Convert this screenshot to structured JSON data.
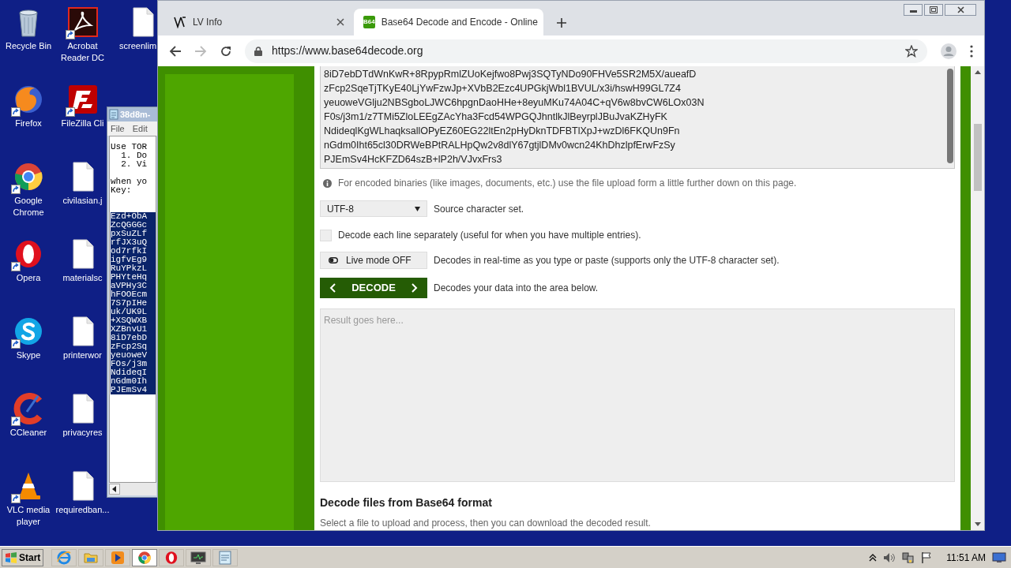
{
  "desktop": {
    "columns": [
      [
        {
          "label": "Recycle Bin",
          "kind": "recycle"
        },
        {
          "label": "Firefox",
          "kind": "firefox"
        },
        {
          "label": "Google Chrome",
          "kind": "chrome"
        },
        {
          "label": "Opera",
          "kind": "opera"
        },
        {
          "label": "Skype",
          "kind": "skype"
        },
        {
          "label": "CCleaner",
          "kind": "ccleaner"
        },
        {
          "label": "VLC media player",
          "kind": "vlc"
        }
      ],
      [
        {
          "label": "Acrobat Reader DC",
          "kind": "acrobat"
        },
        {
          "label": "FileZilla Cli",
          "kind": "filezilla"
        },
        {
          "label": "civilasian.j",
          "kind": "file"
        },
        {
          "label": "materialsc",
          "kind": "file"
        },
        {
          "label": "printerwor",
          "kind": "file"
        },
        {
          "label": "privacyres",
          "kind": "file"
        },
        {
          "label": "requiredban...",
          "kind": "file"
        }
      ],
      [
        {
          "label": "screenlim",
          "kind": "file"
        }
      ]
    ]
  },
  "notepad": {
    "title": "38d8m-",
    "menu": [
      "File",
      "Edit"
    ],
    "paragraphs": [
      [
        "Use TOR",
        "  1. Do",
        "  2. Vi"
      ],
      [
        "when yo",
        "Key:"
      ]
    ],
    "selected_lines": [
      "Ezd+ObA",
      "ZcQGGGc",
      "pxSuZLf",
      "rfJX3uQ",
      "od7rfkI",
      "igfvEg9",
      "RuYPkzL",
      "PHYteHq",
      "aVPHy3C",
      "hFOOEcm",
      "7S7pIHe",
      "uk/UK9L",
      "+XSQWXB",
      "XZBnvU1",
      "8iD7ebD",
      "zFcp2Sq",
      "yeuoweV",
      "FOs/j3m",
      "NdideqI",
      "nGdm0Ih",
      "PJEmSv4"
    ]
  },
  "browser": {
    "tabs": [
      {
        "title": "LV Info",
        "kind": "lv",
        "selected": false
      },
      {
        "title": "Base64 Decode and Encode - Online",
        "kind": "b64",
        "favicon_text": "B64",
        "selected": true
      }
    ],
    "url": "https://www.base64decode.org",
    "page": {
      "input_lines": [
        "8iD7ebDTdWnKwR+8RpypRmlZUoKejfwo8Pwj3SQTyNDo90FHVe5SR2M5X/aueafD",
        "zFcp2SqeTjTKyE40LjYwFzwJp+XVbB2Ezc4UPGkjWbl1BVUL/x3i/hswH99GL7Z4",
        "yeuoweVGlju2NBSgboLJWC6hpgnDaoHHe+8eyuMKu74A04C+qV6w8bvCW6LOx03N",
        "F0s/j3m1/z7TMi5ZloLEEgZAcYha3Fcd54WPGQJhntlkJlBeyrplJBuJvaKZHyFK",
        "NdideqlKgWLhaqksallOPyEZ60EG22ltEn2pHyDknTDFBTlXpJ+wzDl6FKQUn9Fn",
        "nGdm0Iht65cl30DRWeBPtRALHpQw2v8dlY67gtjlDMv0wcn24KhDhzlpfErwFzSy",
        "PJEmSv4HcKFZD64szB+lP2h/VJvxFrs3"
      ],
      "info_note": "For encoded binaries (like images, documents, etc.) use the file upload form a little further down on this page.",
      "charset": {
        "value": "UTF-8",
        "label": "Source character set."
      },
      "line_option": {
        "checked": false,
        "label": "Decode each line separately (useful for when you have multiple entries)."
      },
      "live_mode": {
        "on": false,
        "button": "Live mode OFF",
        "label": "Decodes in real-time as you type or paste (supports only the UTF-8 character set)."
      },
      "decode": {
        "button": "DECODE",
        "label": "Decodes your data into the area below."
      },
      "result": {
        "placeholder": "Result goes here..."
      },
      "files_heading": "Decode files from Base64 format",
      "files_text": "Select a file to upload and process, then you can download the decoded result."
    }
  },
  "taskbar": {
    "start": "Start",
    "apps": [
      {
        "kind": "ie",
        "selected": false
      },
      {
        "kind": "folder",
        "selected": false
      },
      {
        "kind": "media",
        "selected": false
      },
      {
        "kind": "chrome",
        "selected": true
      },
      {
        "kind": "opera",
        "selected": false
      },
      {
        "kind": "monitor",
        "selected": false
      },
      {
        "kind": "notepad",
        "selected": false
      }
    ],
    "clock": "11:51 AM"
  }
}
